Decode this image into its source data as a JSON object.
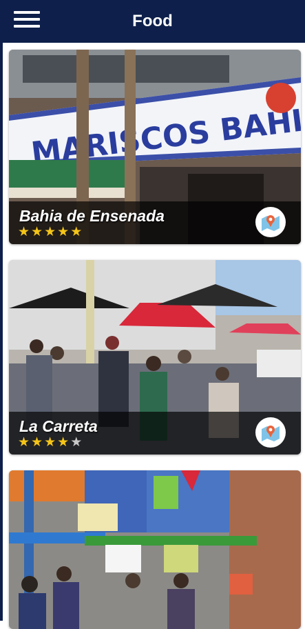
{
  "header": {
    "title": "Food",
    "menu_icon": "hamburger-menu-icon"
  },
  "restaurants": [
    {
      "name": "Bahia de Ensenada",
      "rating": 5,
      "max_rating": 5,
      "map_icon": "map-pin-icon"
    },
    {
      "name": "La Carreta",
      "rating": 4,
      "max_rating": 5,
      "map_icon": "map-pin-icon"
    },
    {
      "name": "",
      "rating": null,
      "max_rating": 5,
      "map_icon": "map-pin-icon"
    }
  ],
  "colors": {
    "appbar": "#0d1f4a",
    "star_on": "#f5c518",
    "star_off": "#c8c8c8",
    "map_pin": "#e8643c"
  }
}
